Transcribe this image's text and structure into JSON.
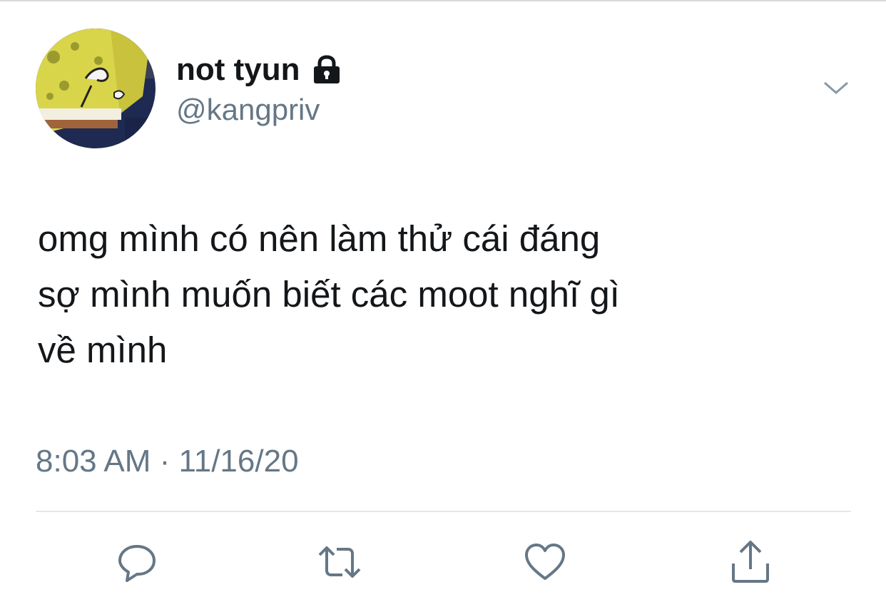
{
  "tweet": {
    "author": {
      "display_name": "not tyun",
      "handle": "@kangpriv",
      "protected_icon": "lock-icon",
      "avatar": "spongebob-avatar"
    },
    "menu_icon": "chevron-down-icon",
    "text_lines": [
      "omg mình có nên làm thử cái đáng",
      "sợ mình muốn biết các moot nghĩ gì",
      "về mình"
    ],
    "timestamp": "8:03 AM · 11/16/20",
    "actions": [
      {
        "name": "reply",
        "icon": "reply-icon"
      },
      {
        "name": "retweet",
        "icon": "retweet-icon"
      },
      {
        "name": "like",
        "icon": "heart-icon"
      },
      {
        "name": "share",
        "icon": "share-icon"
      }
    ]
  },
  "colors": {
    "text_primary": "#14171a",
    "text_secondary": "#657786",
    "icon": "#657786",
    "divider": "#e1e8ed"
  }
}
